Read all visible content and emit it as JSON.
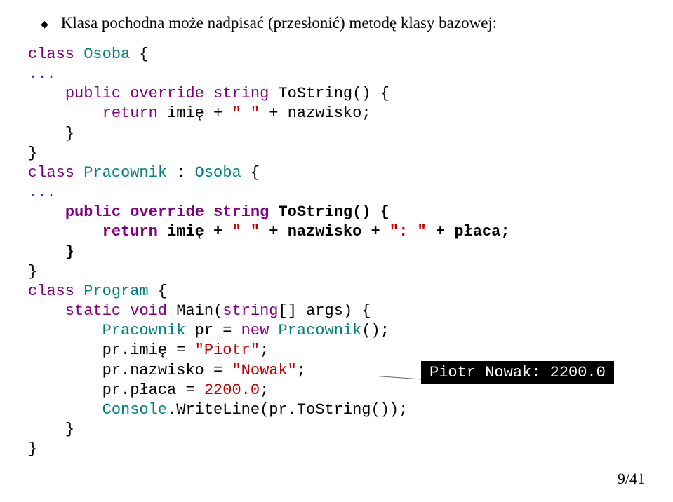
{
  "bullet_text": "Klasa pochodna może nadpisać (przesłonić) metodę klasy bazowej:",
  "c": {
    "class_kw": "class",
    "public_kw": "public",
    "override_kw": "override",
    "string_kw": "string",
    "return_kw": "return",
    "static_kw": "static",
    "void_kw": "void",
    "new_kw": "new",
    "osoba": "Osoba",
    "pracownik": "Pracownik",
    "program": "Program",
    "tostring": "ToString",
    "main": "Main",
    "writeline": "WriteLine",
    "console": "Console",
    "imie": "imię",
    "nazwisko": "nazwisko",
    "placa": "płaca",
    "pr": "pr",
    "args": "args",
    "colon_inherit": " : ",
    "dots": "...",
    "obr": " {",
    "cbr": "}",
    "paren_empty": "()",
    "semi": ";",
    "eq": " = ",
    "plus": " + ",
    "dot": ".",
    "comma": ",",
    "sq_open": "[",
    "sq_close": "]",
    "str_space": "\" \"",
    "str_colon_space": "\": \"",
    "str_piotr": "\"Piotr\"",
    "str_nowak": "\"Nowak\"",
    "num_placa": "2200.0"
  },
  "output": "Piotr Nowak: 2200.0",
  "page_number": "9/41"
}
